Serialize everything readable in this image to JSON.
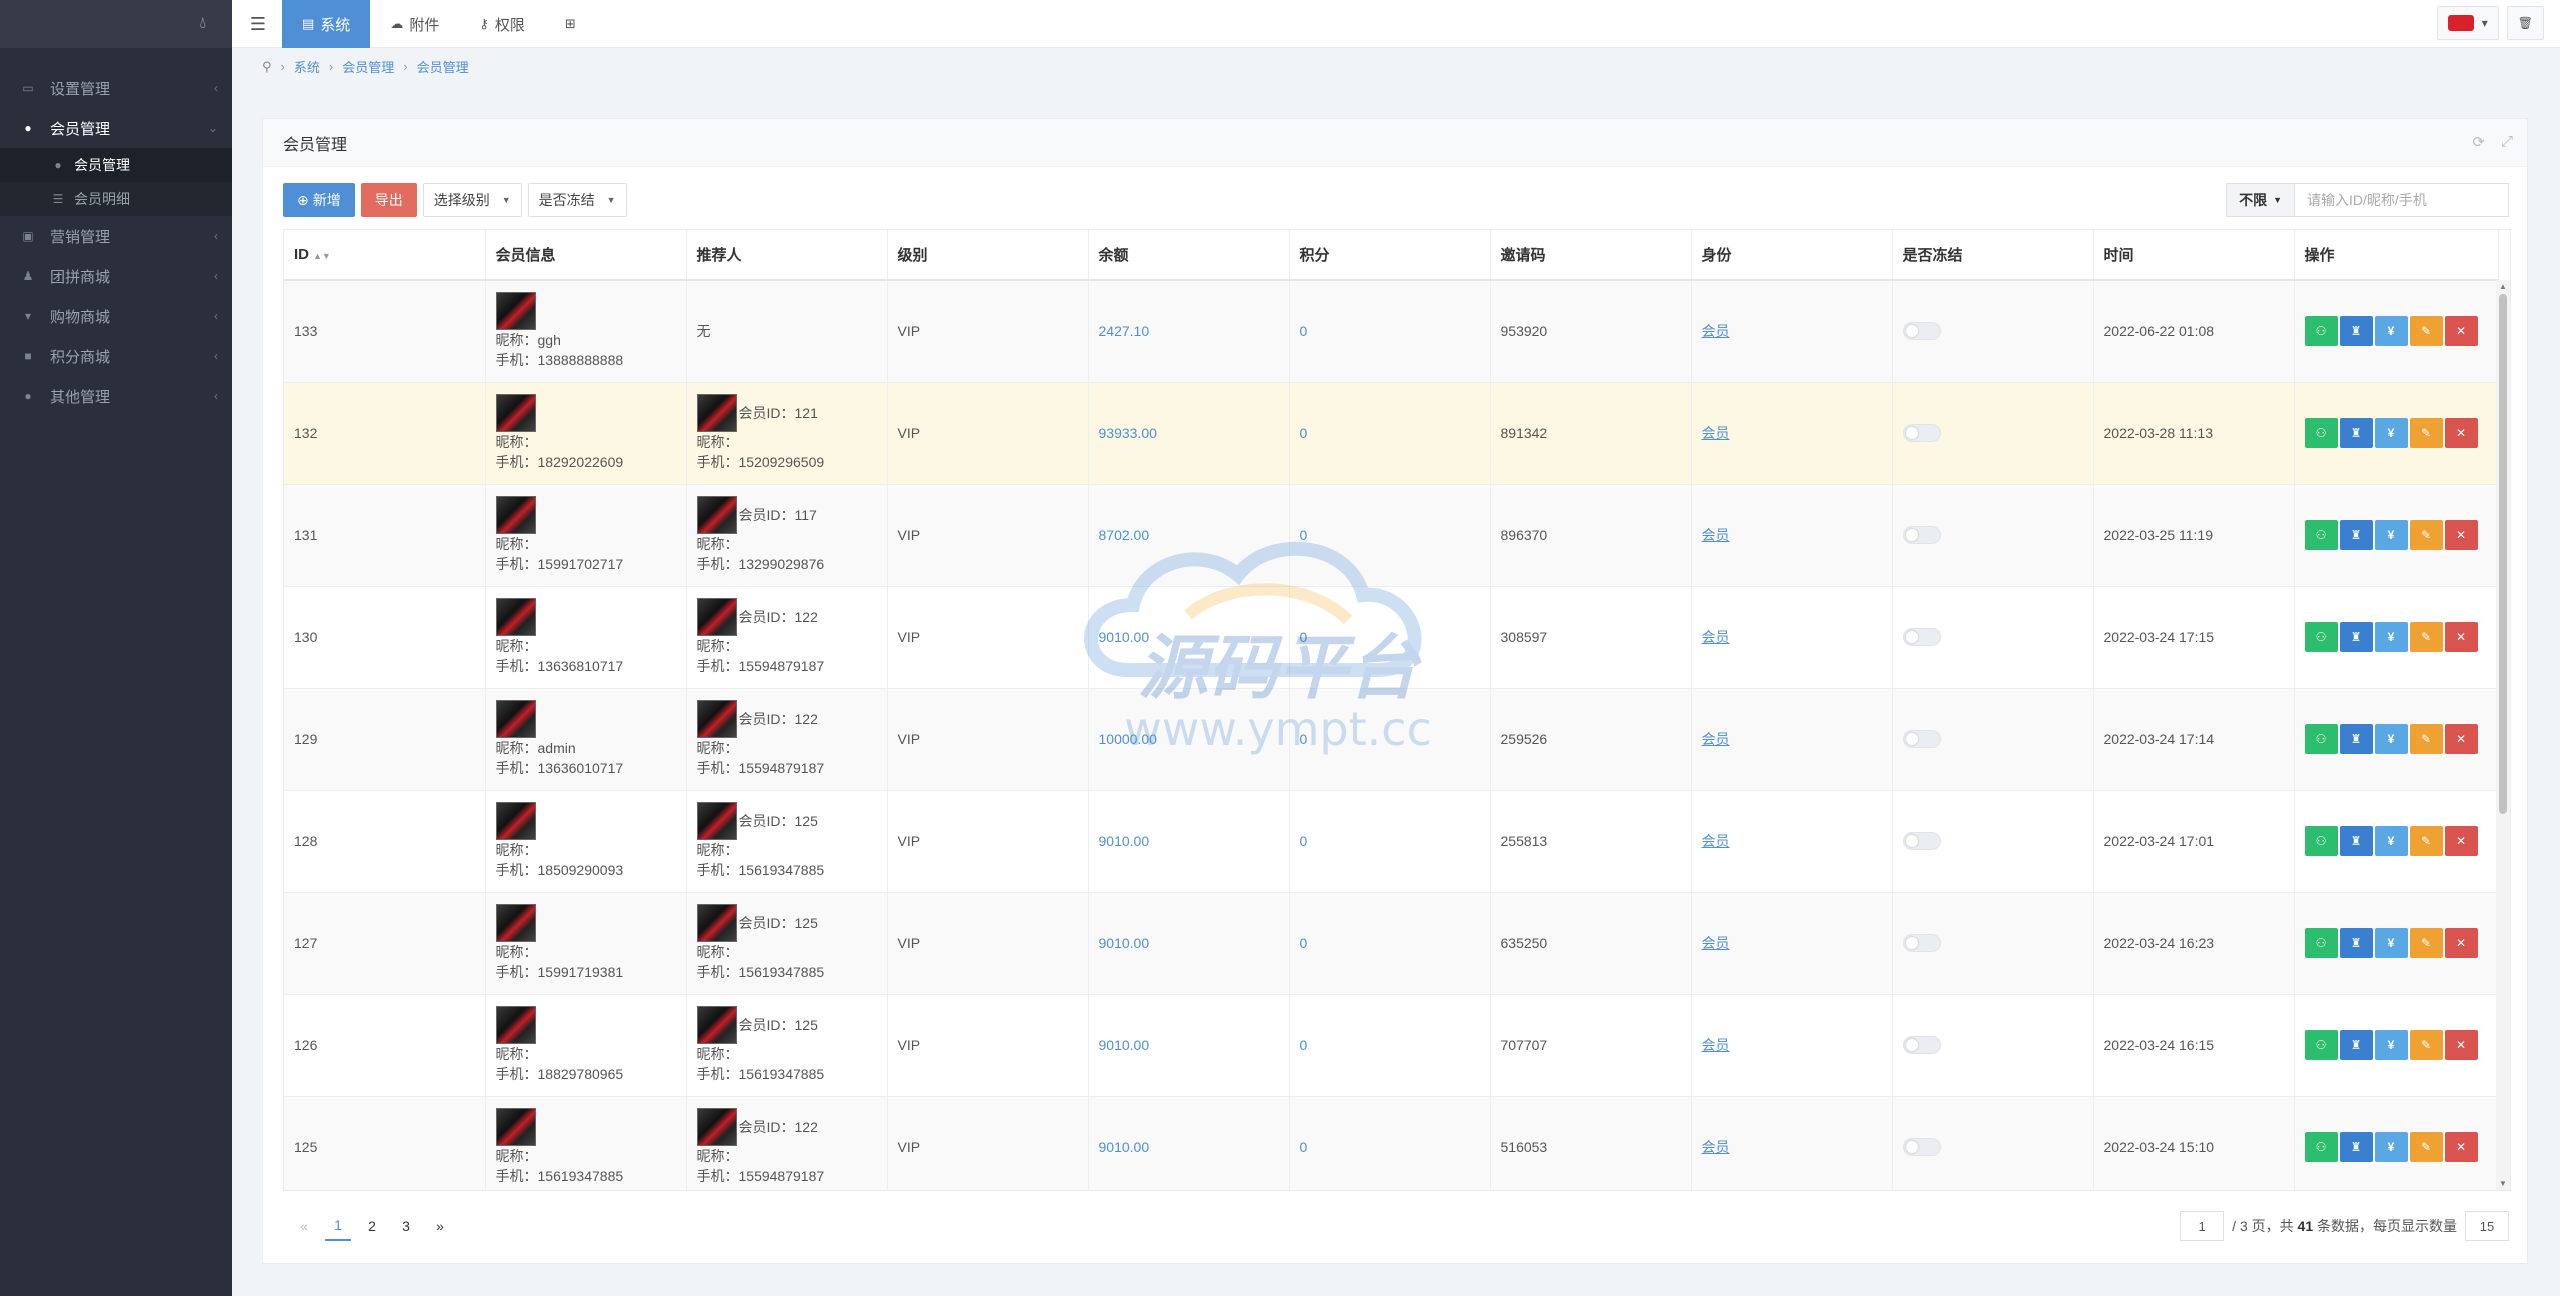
{
  "sidebar": {
    "logo_icon": "drop-icon",
    "items": [
      {
        "label": "设置管理",
        "icon": "folder-icon"
      },
      {
        "label": "会员管理",
        "icon": "user-circle-icon"
      },
      {
        "label": "营销管理",
        "icon": "tag-icon"
      },
      {
        "label": "团拼商城",
        "icon": "users-icon"
      },
      {
        "label": "购物商城",
        "icon": "cart-icon"
      },
      {
        "label": "积分商城",
        "icon": "bag-icon"
      },
      {
        "label": "其他管理",
        "icon": "chat-icon"
      }
    ],
    "sub_items": [
      {
        "label": "会员管理",
        "icon": "user-icon"
      },
      {
        "label": "会员明细",
        "icon": "list-icon"
      }
    ]
  },
  "topbar": {
    "tabs": [
      {
        "label": "系统",
        "icon": "id-card-icon"
      },
      {
        "label": "附件",
        "icon": "cloud-icon"
      },
      {
        "label": "权限",
        "icon": "key-icon"
      }
    ],
    "grid_icon": "grid-icon"
  },
  "breadcrumb": {
    "items": [
      "系统",
      "会员管理",
      "会员管理"
    ]
  },
  "panel": {
    "title": "会员管理"
  },
  "toolbar": {
    "add_label": "新增",
    "export_label": "导出",
    "level_select": "选择级别",
    "frozen_select": "是否冻结"
  },
  "search": {
    "scope": "不限",
    "placeholder": "请输入ID/昵称/手机"
  },
  "table": {
    "headers": [
      "ID",
      "会员信息",
      "推荐人",
      "级别",
      "余额",
      "积分",
      "邀请码",
      "身份",
      "是否冻结",
      "时间",
      "操作"
    ],
    "rows": [
      {
        "id": "133",
        "nick": "昵称：ggh",
        "phone": "手机：13888888888",
        "ref_id": "",
        "ref_nick": "",
        "ref_phone": "",
        "ref_none": "无",
        "level": "VIP",
        "balance": "2427.10",
        "points": "0",
        "invite": "953920",
        "identity": "会员",
        "frozen": false,
        "time": "2022-06-22 01:08"
      },
      {
        "id": "132",
        "nick": "昵称：",
        "phone": "手机：18292022609",
        "ref_id": "会员ID：121",
        "ref_nick": "昵称：",
        "ref_phone": "手机：15209296509",
        "ref_none": "",
        "level": "VIP",
        "balance": "93933.00",
        "points": "0",
        "invite": "891342",
        "identity": "会员",
        "frozen": false,
        "time": "2022-03-28 11:13"
      },
      {
        "id": "131",
        "nick": "昵称：",
        "phone": "手机：15991702717",
        "ref_id": "会员ID：117",
        "ref_nick": "昵称：",
        "ref_phone": "手机：13299029876",
        "ref_none": "",
        "level": "VIP",
        "balance": "8702.00",
        "points": "0",
        "invite": "896370",
        "identity": "会员",
        "frozen": false,
        "time": "2022-03-25 11:19"
      },
      {
        "id": "130",
        "nick": "昵称：",
        "phone": "手机：13636810717",
        "ref_id": "会员ID：122",
        "ref_nick": "昵称：",
        "ref_phone": "手机：15594879187",
        "ref_none": "",
        "level": "VIP",
        "balance": "9010.00",
        "points": "0",
        "invite": "308597",
        "identity": "会员",
        "frozen": false,
        "time": "2022-03-24 17:15"
      },
      {
        "id": "129",
        "nick": "昵称：admin",
        "phone": "手机：13636010717",
        "ref_id": "会员ID：122",
        "ref_nick": "昵称：",
        "ref_phone": "手机：15594879187",
        "ref_none": "",
        "level": "VIP",
        "balance": "10000.00",
        "points": "0",
        "invite": "259526",
        "identity": "会员",
        "frozen": false,
        "time": "2022-03-24 17:14"
      },
      {
        "id": "128",
        "nick": "昵称：",
        "phone": "手机：18509290093",
        "ref_id": "会员ID：125",
        "ref_nick": "昵称：",
        "ref_phone": "手机：15619347885",
        "ref_none": "",
        "level": "VIP",
        "balance": "9010.00",
        "points": "0",
        "invite": "255813",
        "identity": "会员",
        "frozen": false,
        "time": "2022-03-24 17:01"
      },
      {
        "id": "127",
        "nick": "昵称：",
        "phone": "手机：15991719381",
        "ref_id": "会员ID：125",
        "ref_nick": "昵称：",
        "ref_phone": "手机：15619347885",
        "ref_none": "",
        "level": "VIP",
        "balance": "9010.00",
        "points": "0",
        "invite": "635250",
        "identity": "会员",
        "frozen": false,
        "time": "2022-03-24 16:23"
      },
      {
        "id": "126",
        "nick": "昵称：",
        "phone": "手机：18829780965",
        "ref_id": "会员ID：125",
        "ref_nick": "昵称：",
        "ref_phone": "手机：15619347885",
        "ref_none": "",
        "level": "VIP",
        "balance": "9010.00",
        "points": "0",
        "invite": "707707",
        "identity": "会员",
        "frozen": false,
        "time": "2022-03-24 16:15"
      },
      {
        "id": "125",
        "nick": "昵称：",
        "phone": "手机：15619347885",
        "ref_id": "会员ID：122",
        "ref_nick": "昵称：",
        "ref_phone": "手机：15594879187",
        "ref_none": "",
        "level": "VIP",
        "balance": "9010.00",
        "points": "0",
        "invite": "516053",
        "identity": "会员",
        "frozen": false,
        "time": "2022-03-24 15:10"
      }
    ],
    "op_buttons": [
      {
        "icon": "sitemap-icon",
        "glyph": "⚇",
        "color": "#2dbd6e"
      },
      {
        "icon": "shirt-icon",
        "glyph": "♜",
        "color": "#3b7fd0"
      },
      {
        "icon": "yen-icon",
        "glyph": "¥",
        "color": "#5aa8e3"
      },
      {
        "icon": "pencil-icon",
        "glyph": "✎",
        "color": "#f0a133"
      },
      {
        "icon": "close-icon",
        "glyph": "✕",
        "color": "#d9534f"
      }
    ]
  },
  "pagination": {
    "prev": "«",
    "pages": [
      "1",
      "2",
      "3"
    ],
    "current": "1",
    "next": "»",
    "page_input": "1",
    "info_pre": "/ 3 页，共 ",
    "total": "41",
    "info_post": " 条数据，每页显示数量",
    "per_page": "15"
  },
  "watermark": {
    "title": "源码平台",
    "url": "www.ympt.cc"
  }
}
